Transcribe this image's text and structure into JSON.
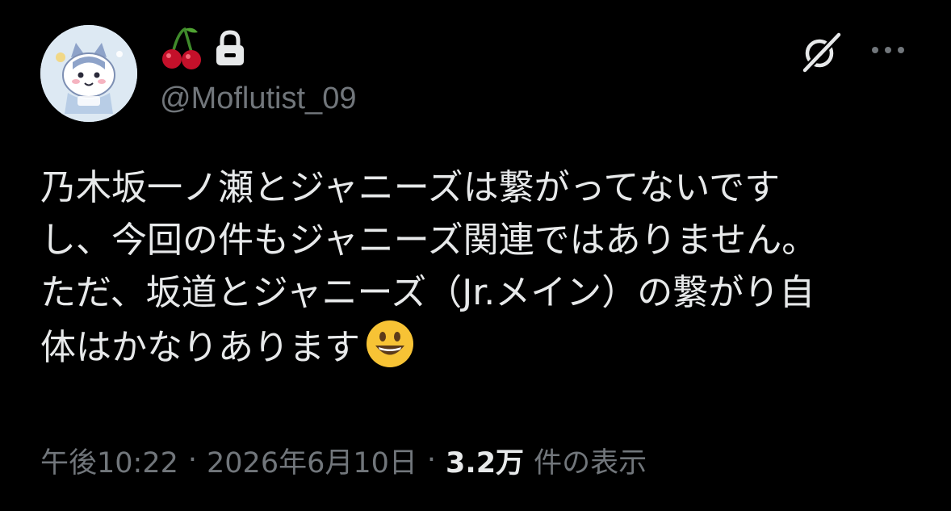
{
  "author": {
    "handle": "@Moflutist_09",
    "name_emoji": "cherries",
    "protected": true,
    "avatar": "chiikawa-hachiware-character"
  },
  "header_actions": {
    "grok_icon": "grok-icon",
    "more_icon": "more-options-icon"
  },
  "tweet": {
    "lines": [
      "乃木坂一ノ瀬とジャニーズは繋がってないです",
      "し、今回の件もジャニーズ関連ではありません。",
      "ただ、坂道とジャニーズ（Jr.メイン）の繋がり自",
      "体はかなりあります"
    ],
    "trailing_emoji": "grinning-face"
  },
  "meta": {
    "time": "午後10:22",
    "dot1": "·",
    "date": "2026年6月10日",
    "dot2": "·",
    "views_count": "3.2万",
    "views_label": "件の表示"
  },
  "colors": {
    "background": "#000000",
    "text": "#e7e9ea",
    "secondary": "#71767b",
    "cherry": "#c4102a",
    "emoji_yellow": "#f7c335"
  }
}
